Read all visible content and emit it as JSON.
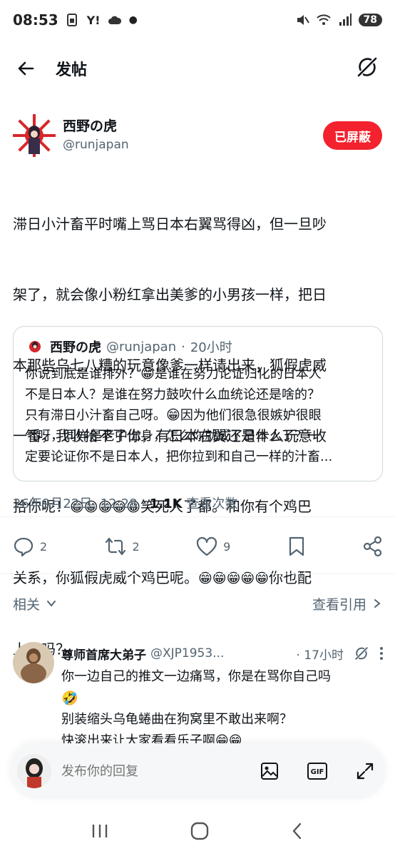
{
  "status_bar": {
    "time": "08:53",
    "battery": "78"
  },
  "header": {
    "title": "发帖"
  },
  "post": {
    "display_name": "西野の虎",
    "handle": "@runjapan",
    "blocked_label": "已屏蔽",
    "text_line1": "滞日小汁畜平时嘴上骂日本右翼骂得凶，但一旦吵",
    "text_line2": "架了，就会像小粉红拿出美爹的小男孩一样，把日",
    "text_line3": "本那些乌七八糟的玩意像爹一样请出来，狐假虎威",
    "text_line4": "一番，我收拾不了你，有日本右翼还是什么玩意收",
    "text_line5a": "拾你呢！",
    "text_line5b": "😁😁😁😁😁",
    "text_line5c": "笑死人了都。和你有个鸡巴",
    "text_line6a": "关系，你狐假虎威个鸡巴呢。",
    "text_line6b": "😁😁😁😁😁",
    "text_line6c": "你也配",
    "text_line7": "上桌吗？",
    "timestamp": "26年9月22日, 12:28",
    "views_count": "1.1K",
    "views_label": "查看次数"
  },
  "quote": {
    "display_name": "西野の虎",
    "handle": "@runjapan",
    "separator": "·",
    "time": "20小时",
    "line1a": "你说到底是谁排外？",
    "line1b": "😁",
    "line1c": "是谁在努力论证归化的日本人",
    "line2": "不是日本人？是谁在努力鼓吹什么血统论还是啥的？",
    "line3a": "只有滞日小汁畜自己呀。",
    "line3b": "😁",
    "line3c": "因为他们很急很嫉妒很眼",
    "line4": "气呀，同样是老中出身，怎么你就成了日本人了？一",
    "line5": "定要论证你不是日本人，把你拉到和自己一样的汁畜..."
  },
  "actions": {
    "replies": "2",
    "retweets": "2",
    "likes": "9"
  },
  "related": {
    "label": "相关",
    "view_quotes": "查看引用"
  },
  "reply": {
    "display_name": "尊师首席大弟子",
    "handle": "@XJP1953...",
    "time": "· 17小时",
    "line1": "你一边自己的推文一边痛骂，你是在骂你自己吗",
    "line2": "🤣",
    "line3": "别装缩头乌龟蜷曲在狗窝里不敢出来啊？",
    "line4": "快滚出来让大家看看乐子啊😁😁"
  },
  "composer": {
    "placeholder": "发布你的回复"
  },
  "colors": {
    "blocked_red": "#f4212e",
    "text": "#0f1419",
    "muted": "#536471",
    "border": "#cfd9de"
  }
}
